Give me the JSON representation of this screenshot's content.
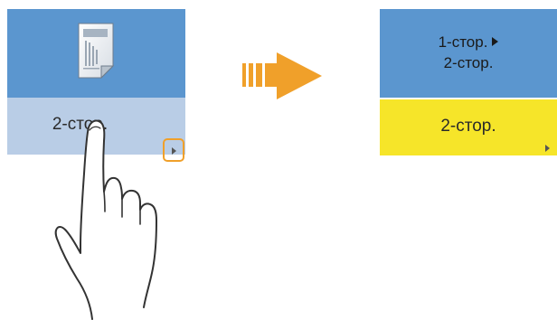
{
  "left_tile": {
    "label": "2-стор.",
    "icon": "document-duplex-icon",
    "arrow_icon": "triangle-right-icon"
  },
  "transition_arrow": {
    "icon": "right-arrow-icon",
    "color": "#f0a02a"
  },
  "right_tile": {
    "top_line1": "1-стор.",
    "top_line2": "2-стор.",
    "bottom_label": "2-стор.",
    "top_color": "#5b96cf",
    "bottom_color": "#f6e529"
  },
  "colors": {
    "tile_blue": "#5b96cf",
    "tile_light_blue": "#b9cde6",
    "highlight_orange": "#f0a02a",
    "selected_yellow": "#f6e529"
  },
  "hand": {
    "icon": "pointing-hand-icon"
  }
}
